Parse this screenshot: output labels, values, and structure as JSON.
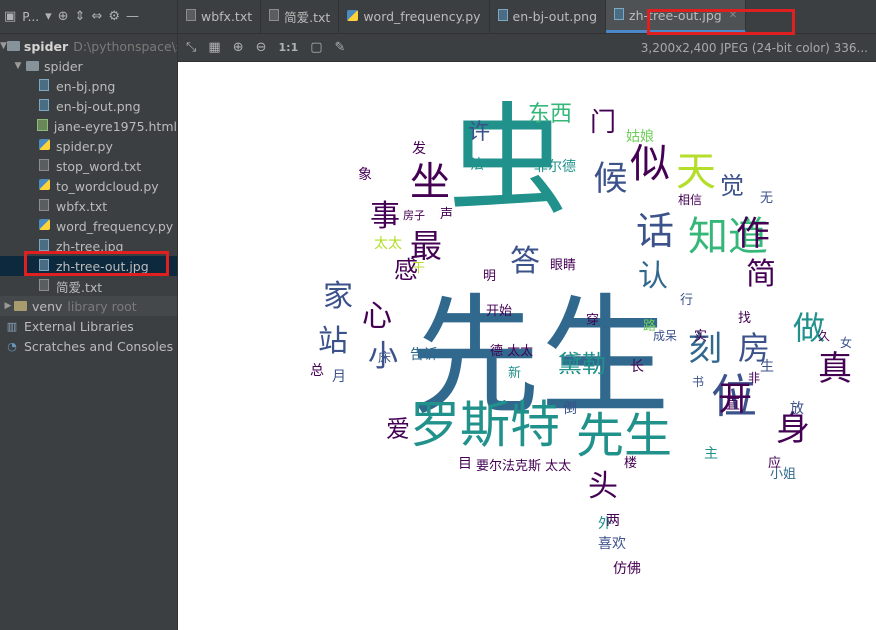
{
  "sidebar": {
    "toolbar_title": "P...",
    "items": [
      {
        "label": "spider",
        "hint": "D:\\pythonspace\\sp"
      },
      {
        "label": "spider"
      },
      {
        "label": "en-bj.png"
      },
      {
        "label": "en-bj-out.png"
      },
      {
        "label": "jane-eyre1975.html"
      },
      {
        "label": "spider.py"
      },
      {
        "label": "stop_word.txt"
      },
      {
        "label": "to_wordcloud.py"
      },
      {
        "label": "wbfx.txt"
      },
      {
        "label": "word_frequency.py"
      },
      {
        "label": "zh-tree.jpg"
      },
      {
        "label": "zh-tree-out.jpg"
      },
      {
        "label": "简爱.txt"
      },
      {
        "label": "venv",
        "hint": "library root"
      },
      {
        "label": "External Libraries"
      },
      {
        "label": "Scratches and Consoles"
      }
    ]
  },
  "tabs": [
    {
      "label": "wbfx.txt"
    },
    {
      "label": "简爱.txt"
    },
    {
      "label": "word_frequency.py"
    },
    {
      "label": "en-bj-out.png"
    },
    {
      "label": "zh-tree-out.jpg"
    }
  ],
  "image_toolbar": {
    "zoom_label": "1:1",
    "info": "3,200x2,400 JPEG (24-bit color) 336..."
  },
  "wordcloud": {
    "words": [
      {
        "t": "先生",
        "c": "#31688e"
      },
      {
        "t": "虫",
        "c": "#21918c"
      },
      {
        "t": "罗斯特",
        "c": "#21918c"
      },
      {
        "t": "先生",
        "c": "#21918c"
      },
      {
        "t": "位",
        "c": "#3b528b"
      },
      {
        "t": "知道",
        "c": "#35b779"
      },
      {
        "t": "坐",
        "c": "#440154"
      },
      {
        "t": "似",
        "c": "#440154"
      },
      {
        "t": "天",
        "c": "#b5de2b"
      },
      {
        "t": "话",
        "c": "#3b528b"
      },
      {
        "t": "作",
        "c": "#440154"
      },
      {
        "t": "候",
        "c": "#3b528b"
      },
      {
        "t": "最",
        "c": "#440154"
      },
      {
        "t": "事",
        "c": "#440154"
      },
      {
        "t": "家",
        "c": "#3b528b"
      },
      {
        "t": "心",
        "c": "#440154"
      },
      {
        "t": "小",
        "c": "#3b528b"
      },
      {
        "t": "站",
        "c": "#3b528b"
      },
      {
        "t": "简",
        "c": "#440154"
      },
      {
        "t": "做",
        "c": "#21918c"
      },
      {
        "t": "房",
        "c": "#3b528b"
      },
      {
        "t": "真",
        "c": "#440154"
      },
      {
        "t": "刻",
        "c": "#31688e"
      },
      {
        "t": "开",
        "c": "#440154"
      },
      {
        "t": "身",
        "c": "#440154"
      },
      {
        "t": "头",
        "c": "#440154"
      },
      {
        "t": "东西",
        "c": "#35b779"
      },
      {
        "t": "门",
        "c": "#440154"
      },
      {
        "t": "许",
        "c": "#3b528b"
      },
      {
        "t": "答",
        "c": "#3b528b"
      },
      {
        "t": "认",
        "c": "#31688e"
      },
      {
        "t": "觉",
        "c": "#3b528b"
      },
      {
        "t": "感",
        "c": "#440154"
      },
      {
        "t": "黛勒",
        "c": "#21918c"
      },
      {
        "t": "爱",
        "c": "#440154"
      },
      {
        "t": "告诉",
        "c": "#31688e"
      },
      {
        "t": "姑娘",
        "c": "#6ece58"
      },
      {
        "t": "菲尔德",
        "c": "#21918c"
      },
      {
        "t": "相信",
        "c": "#440154"
      },
      {
        "t": "眼睛",
        "c": "#440154"
      },
      {
        "t": "开始",
        "c": "#440154"
      },
      {
        "t": "穿",
        "c": "#440154"
      },
      {
        "t": "路",
        "c": "#6ece58"
      },
      {
        "t": "成呆",
        "c": "#3b528b"
      },
      {
        "t": "要尔法克斯 太太",
        "c": "#440154"
      },
      {
        "t": "喜欢",
        "c": "#3b528b"
      },
      {
        "t": "仿佛",
        "c": "#440154"
      },
      {
        "t": "外",
        "c": "#21918c"
      },
      {
        "t": "两",
        "c": "#440154"
      },
      {
        "t": "小姐",
        "c": "#31688e"
      },
      {
        "t": "楼",
        "c": "#440154"
      },
      {
        "t": "放",
        "c": "#3b528b"
      },
      {
        "t": "久",
        "c": "#440154"
      },
      {
        "t": "女",
        "c": "#3b528b"
      },
      {
        "t": "应",
        "c": "#440154"
      },
      {
        "t": "月",
        "c": "#3b528b"
      },
      {
        "t": "床",
        "c": "#3b528b"
      },
      {
        "t": "总",
        "c": "#440154"
      },
      {
        "t": "德 太太",
        "c": "#440154"
      },
      {
        "t": "主",
        "c": "#21918c"
      },
      {
        "t": "长",
        "c": "#440154"
      },
      {
        "t": "书",
        "c": "#3b528b"
      },
      {
        "t": "非",
        "c": "#440154"
      },
      {
        "t": "找",
        "c": "#440154"
      },
      {
        "t": "无",
        "c": "#3b528b"
      },
      {
        "t": "干",
        "c": "#b5de2b"
      },
      {
        "t": "太太",
        "c": "#b5de2b"
      },
      {
        "t": "象",
        "c": "#440154"
      },
      {
        "t": "法",
        "c": "#21918c"
      },
      {
        "t": "发",
        "c": "#440154"
      },
      {
        "t": "声",
        "c": "#440154"
      },
      {
        "t": "房子",
        "c": "#440154"
      },
      {
        "t": "倒",
        "c": "#3b528b"
      },
      {
        "t": "目",
        "c": "#440154"
      },
      {
        "t": "新",
        "c": "#21918c"
      },
      {
        "t": "明",
        "c": "#440154"
      },
      {
        "t": "实",
        "c": "#440154"
      },
      {
        "t": "行",
        "c": "#3b528b"
      },
      {
        "t": "直",
        "c": "#440154"
      },
      {
        "t": "生",
        "c": "#3b528b"
      }
    ]
  }
}
